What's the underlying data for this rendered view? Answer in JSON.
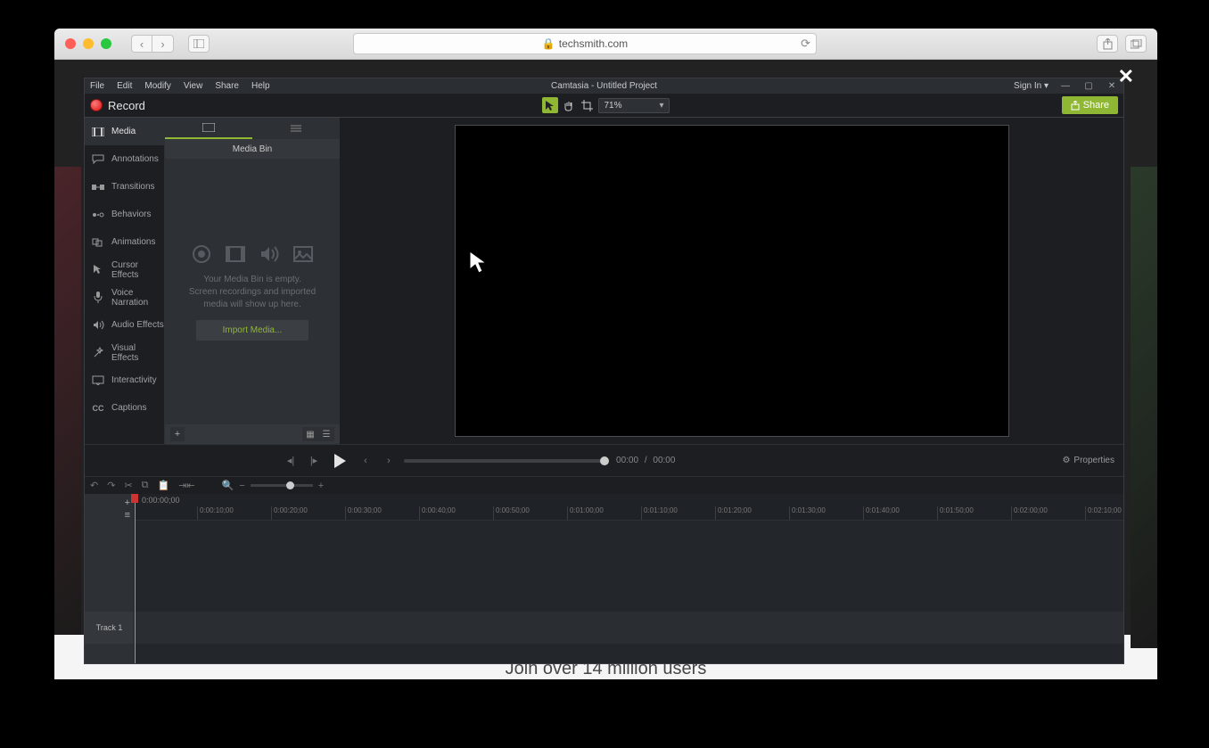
{
  "browser": {
    "url": "techsmith.com",
    "page_footer": "Join over 14 million users"
  },
  "app": {
    "title": "Camtasia - Untitled Project",
    "menu": [
      "File",
      "Edit",
      "Modify",
      "View",
      "Share",
      "Help"
    ],
    "sign_in": "Sign In",
    "record": "Record",
    "zoom": "71%",
    "share": "Share"
  },
  "sidebar": [
    {
      "label": "Media"
    },
    {
      "label": "Annotations"
    },
    {
      "label": "Transitions"
    },
    {
      "label": "Behaviors"
    },
    {
      "label": "Animations"
    },
    {
      "label": "Cursor Effects"
    },
    {
      "label": "Voice Narration"
    },
    {
      "label": "Audio Effects"
    },
    {
      "label": "Visual Effects"
    },
    {
      "label": "Interactivity"
    },
    {
      "label": "Captions"
    }
  ],
  "panel": {
    "title": "Media Bin",
    "empty_line1": "Your Media Bin is empty.",
    "empty_line2": "Screen recordings and imported media will show up here.",
    "import": "Import Media..."
  },
  "playback": {
    "current": "00:00",
    "sep": "/",
    "total": "00:00",
    "properties": "Properties"
  },
  "timeline": {
    "playhead_time": "0:00:00;00",
    "track": "Track 1",
    "marks": [
      "0:00:10;00",
      "0:00:20;00",
      "0:00:30;00",
      "0:00:40;00",
      "0:00:50;00",
      "0:01:00;00",
      "0:01:10;00",
      "0:01:20;00",
      "0:01:30;00",
      "0:01:40;00",
      "0:01:50;00",
      "0:02:00;00",
      "0:02:10;00"
    ]
  }
}
